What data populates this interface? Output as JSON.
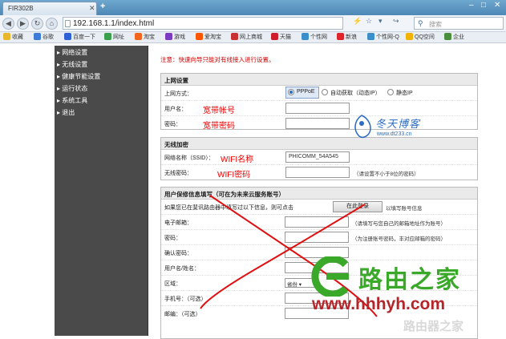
{
  "browser": {
    "tab_title": "FIR302B",
    "url": "192.168.1.1/index.html",
    "search_placeholder": "搜索",
    "favorites": [
      {
        "label": "收藏",
        "color": "#e8b72c"
      },
      {
        "label": "谷歌",
        "color": "#3c7bd8"
      },
      {
        "label": "百度一下",
        "color": "#2e61d6"
      },
      {
        "label": "网址",
        "color": "#3aa04b"
      },
      {
        "label": "淘宝",
        "color": "#f0661f"
      },
      {
        "label": "游戏",
        "color": "#7a3bc2"
      },
      {
        "label": "爱淘宝",
        "color": "#ff5500"
      },
      {
        "label": "网上商城",
        "color": "#c83232"
      },
      {
        "label": "天猫",
        "color": "#d01d2d"
      },
      {
        "label": "个性网",
        "color": "#3a8ec9"
      },
      {
        "label": "新浪",
        "color": "#e0242b"
      },
      {
        "label": "个性网-Q",
        "color": "#3a8ec9"
      },
      {
        "label": "QQ空间",
        "color": "#f2b300"
      },
      {
        "label": "企业",
        "color": "#4a8f3b"
      }
    ]
  },
  "sidebar": {
    "items": [
      "网络设置",
      "无线设置",
      "健康节能设置",
      "运行状态",
      "系统工具",
      "退出"
    ]
  },
  "notice": "注意：快速向导只能对有线接入进行设置。",
  "internet": {
    "heading": "上网设置",
    "type_label": "上网方式：",
    "options": [
      "PPPoE",
      "自动获取（动态IP）",
      "静态IP"
    ],
    "account_label": "用户名：",
    "password_label": "密码：",
    "account_annotation": "宽带帐号",
    "password_annotation": "宽带密码"
  },
  "wireless": {
    "heading": "无线加密",
    "ssid_label": "网络名称（SSID）：",
    "ssid_value": "PHICOMM_54A545",
    "key_label": "无线密码：",
    "key_hint": "（请设置不小于8位的密码）",
    "ssid_annotation": "WIFI名称",
    "key_annotation": "WIFI密码"
  },
  "account": {
    "heading": "用户保修信息填写（可在为未来云服务账号）",
    "intro": "如果您已在斐讯路由器中填写过以下信息，则可点击",
    "login_button": "在此登录",
    "intro_tail": "以填写账号信息",
    "email_label": "电子邮箱：",
    "email_hint": "（请填写与您自己的邮箱地址作为账号）",
    "pwd_label": "密码：",
    "pwd_hint": "（为注册账号密码，丰对应邮箱的密码）",
    "confirm_label": "确认密码：",
    "name_label": "用户名/姓名：",
    "region_label": "区域：",
    "region_value": "省份",
    "phone_label": "手机号：（可选）",
    "mail_label": "邮编：（可选）"
  },
  "watermarks": {
    "blog_title": "冬天博客",
    "blog_url": "www.dt233.cn",
    "site_title": "路由之家",
    "site_url": "www.hhhyh.com",
    "site_sub": "路由器之家"
  },
  "colors": {
    "sidebar_bg": "#4a4a4a",
    "annotation_red": "#e00000",
    "cross_red": "#e01010"
  }
}
